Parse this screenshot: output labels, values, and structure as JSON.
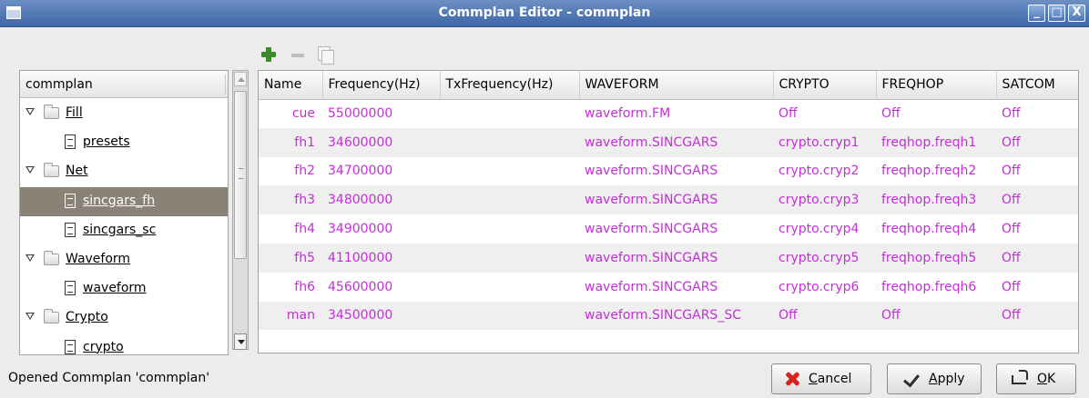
{
  "window": {
    "title": "Commplan Editor - commplan",
    "controls": {
      "minimize": "_",
      "maximize": "□",
      "close": "X"
    }
  },
  "toolbar": {
    "icons": [
      "add-icon",
      "remove-icon",
      "duplicate-icon"
    ]
  },
  "tree": {
    "header": "commplan",
    "nodes": [
      {
        "label": "Fill",
        "type": "folder",
        "expanded": true
      },
      {
        "label": "presets",
        "type": "document"
      },
      {
        "label": "Net",
        "type": "folder",
        "expanded": true
      },
      {
        "label": "sincgars_fh",
        "type": "document",
        "selected": true
      },
      {
        "label": "sincgars_sc",
        "type": "document"
      },
      {
        "label": "Waveform",
        "type": "folder",
        "expanded": true
      },
      {
        "label": "waveform",
        "type": "document"
      },
      {
        "label": "Crypto",
        "type": "folder",
        "expanded": true
      },
      {
        "label": "crypto",
        "type": "document"
      }
    ]
  },
  "table": {
    "columns": [
      "Name",
      "Frequency(Hz)",
      "TxFrequency(Hz)",
      "WAVEFORM",
      "CRYPTO",
      "FREQHOP",
      "SATCOM"
    ],
    "rows": [
      [
        "cue",
        "55000000",
        "",
        "waveform.FM",
        "Off",
        "Off",
        "Off"
      ],
      [
        "fh1",
        "34600000",
        "",
        "waveform.SINCGARS",
        "crypto.cryp1",
        "freqhop.freqh1",
        "Off"
      ],
      [
        "fh2",
        "34700000",
        "",
        "waveform.SINCGARS",
        "crypto.cryp2",
        "freqhop.freqh2",
        "Off"
      ],
      [
        "fh3",
        "34800000",
        "",
        "waveform.SINCGARS",
        "crypto.cryp3",
        "freqhop.freqh3",
        "Off"
      ],
      [
        "fh4",
        "34900000",
        "",
        "waveform.SINCGARS",
        "crypto.cryp4",
        "freqhop.freqh4",
        "Off"
      ],
      [
        "fh5",
        "41100000",
        "",
        "waveform.SINCGARS",
        "crypto.cryp5",
        "freqhop.freqh5",
        "Off"
      ],
      [
        "fh6",
        "45600000",
        "",
        "waveform.SINCGARS",
        "crypto.cryp6",
        "freqhop.freqh6",
        "Off"
      ],
      [
        "man",
        "34500000",
        "",
        "waveform.SINCGARS_SC",
        "Off",
        "Off",
        "Off"
      ]
    ],
    "value_color": "#c32fd6"
  },
  "status": {
    "text": "Opened Commplan 'commplan'"
  },
  "buttons": {
    "cancel": "Cancel",
    "apply": "Apply",
    "ok": "OK"
  }
}
